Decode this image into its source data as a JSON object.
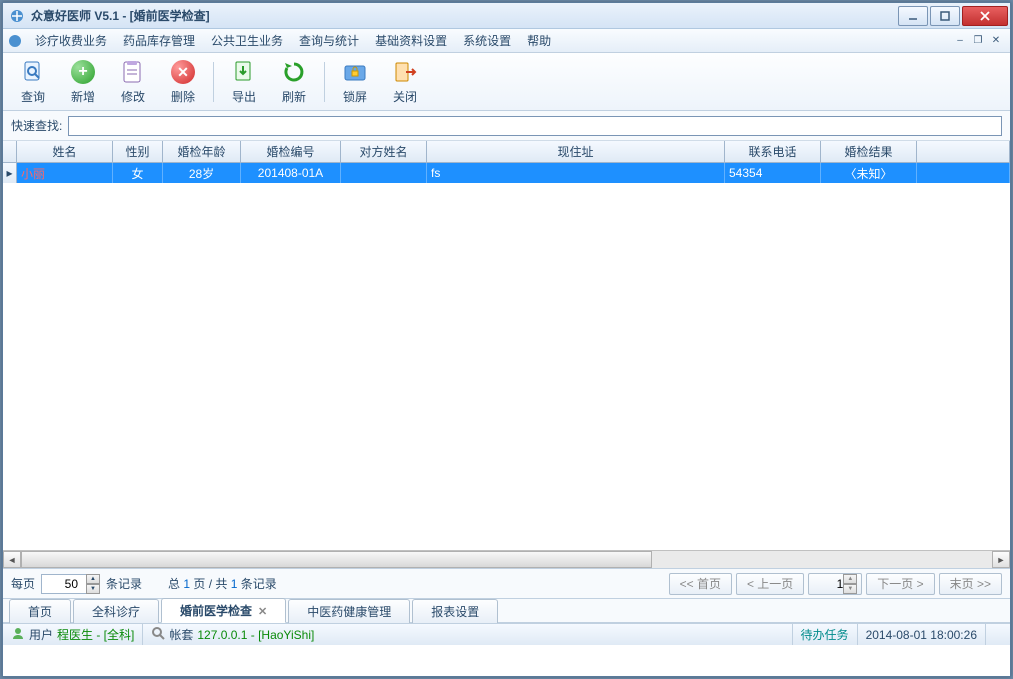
{
  "window": {
    "title": "众意好医师 V5.1 - [婚前医学检查]"
  },
  "menu": {
    "items": [
      "诊疗收费业务",
      "药品库存管理",
      "公共卫生业务",
      "查询与统计",
      "基础资料设置",
      "系统设置",
      "帮助"
    ]
  },
  "toolbar": {
    "query": "查询",
    "add": "新增",
    "edit": "修改",
    "delete": "删除",
    "export": "导出",
    "refresh": "刷新",
    "lock": "锁屏",
    "close": "关闭"
  },
  "search": {
    "label": "快速查找:",
    "value": ""
  },
  "table": {
    "columns": [
      "姓名",
      "性别",
      "婚检年龄",
      "婚检编号",
      "对方姓名",
      "现住址",
      "联系电话",
      "婚检结果"
    ],
    "widths": [
      96,
      50,
      78,
      100,
      86,
      298,
      96,
      96
    ],
    "row": {
      "name": "小丽",
      "gender": "女",
      "age": "28岁",
      "code": "201408-01A",
      "partner": "",
      "address": "fs",
      "phone": "54354",
      "result": "〈未知〉"
    }
  },
  "pager": {
    "per_page_label": "每页",
    "per_page_value": "50",
    "records_label": "条记录",
    "summary_prefix": "总 ",
    "summary_page": "1",
    "summary_mid": " 页 / 共 ",
    "summary_count": "1",
    "summary_suffix": " 条记录",
    "first": "<< 首页",
    "prev": "< 上一页",
    "page_value": "1",
    "next": "下一页 >",
    "last": "末页 >>"
  },
  "tabs": {
    "items": [
      "首页",
      "全科诊疗",
      "婚前医学检查",
      "中医药健康管理",
      "报表设置"
    ],
    "active_index": 2
  },
  "status": {
    "user_label": "用户",
    "user_value": "程医生 - [全科]",
    "acct_label": "帐套",
    "acct_value": "127.0.0.1 - [HaoYiShi]",
    "pending": "待办任务",
    "datetime": "2014-08-01 18:00:26"
  }
}
